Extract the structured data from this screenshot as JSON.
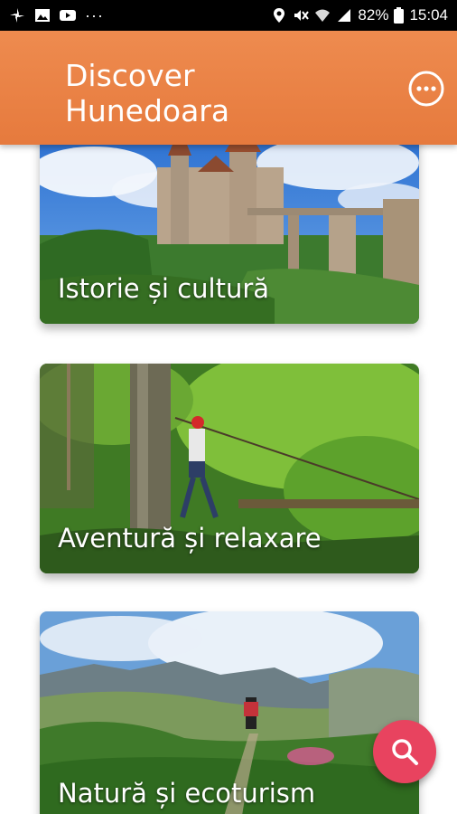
{
  "status_bar": {
    "battery_percent": "82%",
    "time": "15:04",
    "left_icons": [
      "pinwheel-icon",
      "image-icon",
      "youtube-icon",
      "more-notifications-icon"
    ],
    "right_icons": [
      "location-icon",
      "mute-vibrate-icon",
      "wifi-icon",
      "signal-icon",
      "battery-icon"
    ]
  },
  "app_bar": {
    "title": "Discover Hunedoara",
    "menu_icon": "more-horizontal-icon",
    "color": "#ea8244"
  },
  "categories": [
    {
      "label": "Istorie și cultură"
    },
    {
      "label": "Aventură și relaxare"
    },
    {
      "label": "Natură și ecoturism"
    }
  ],
  "fab": {
    "icon": "search-icon",
    "color": "#e8435f"
  }
}
